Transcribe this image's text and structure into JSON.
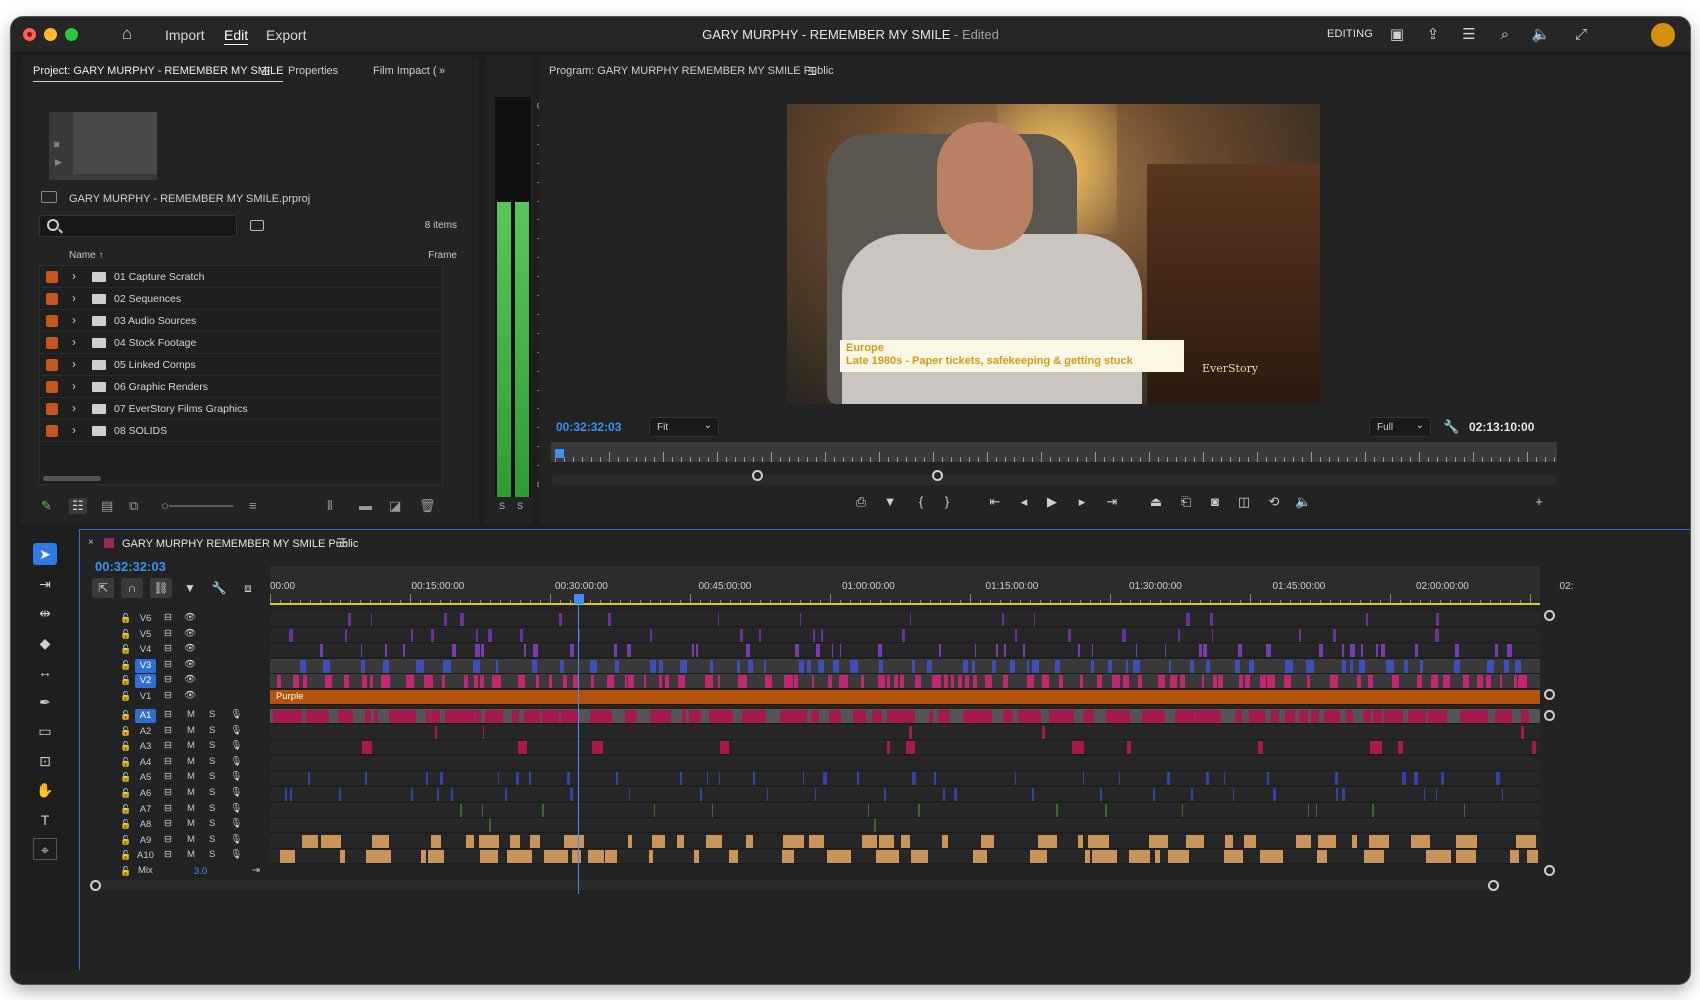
{
  "app": {
    "title": "GARY MURPHY - REMEMBER MY SMILE",
    "title_suffix": "- Edited",
    "menu": [
      "Import",
      "Edit",
      "Export"
    ],
    "workspace": "EDITING",
    "accent": "#3d8ff5"
  },
  "project_panel": {
    "tabs": [
      "Project: GARY MURPHY - REMEMBER MY SMILE",
      "Properties",
      "Film Impact ("
    ],
    "file_name": "GARY MURPHY - REMEMBER MY SMILE.prproj",
    "items_count": "8 items",
    "columns": {
      "name": "Name",
      "frame": "Frame"
    },
    "bins": [
      {
        "label": "01 Capture Scratch",
        "color": "#c4561e"
      },
      {
        "label": "02 Sequences",
        "color": "#c4561e"
      },
      {
        "label": "03 Audio Sources",
        "color": "#c4561e"
      },
      {
        "label": "04 Stock Footage",
        "color": "#c4561e"
      },
      {
        "label": "05 Linked Comps",
        "color": "#c4561e"
      },
      {
        "label": "06 Graphic Renders",
        "color": "#c4561e"
      },
      {
        "label": "07 EverStory Films Graphics",
        "color": "#c4561e"
      },
      {
        "label": "08 SOLIDS",
        "color": "#c4561e"
      }
    ]
  },
  "audio_meter": {
    "ticks": [
      "0",
      "-3",
      "-6",
      "-9",
      "-12",
      "-15",
      "-18",
      "-21",
      "-24",
      "-27",
      "-30",
      "-33",
      "-36",
      "-39",
      "-42",
      "-45",
      "-48",
      "-51",
      "-54",
      "-57",
      "dB"
    ],
    "solo_labels": [
      "S",
      "S"
    ],
    "level_fraction": 0.76
  },
  "program_monitor": {
    "title": "Program: GARY MURPHY REMEMBER MY SMILE Public",
    "timecode": "00:32:32:03",
    "fit": "Fit",
    "resolution": "Full",
    "duration": "02:13:10:00",
    "lower_third": {
      "line1": "Europe",
      "line2": "Late 1980s - Paper tickets, safekeeping & getting stuck"
    },
    "watermark": "EverStory"
  },
  "timeline": {
    "sequence_name": "GARY MURPHY REMEMBER MY SMILE Public",
    "timecode": "00:32:32:03",
    "ruler_labels": [
      "00:00",
      "00:15:00:00",
      "00:30:00:00",
      "00:45:00:00",
      "01:00:00:00",
      "01:15:00:00",
      "01:30:00:00",
      "01:45:00:00",
      "02:00:00:00",
      "02:"
    ],
    "video_tracks": [
      "V6",
      "V5",
      "V4",
      "V3",
      "V2",
      "V1"
    ],
    "audio_tracks": [
      "A1",
      "A2",
      "A3",
      "A4",
      "A5",
      "A6",
      "A7",
      "A8",
      "A9",
      "A10"
    ],
    "track_toggles": {
      "mute": "M",
      "solo": "S"
    },
    "v1_clip": "Purple",
    "mix_label": "Mix",
    "mix_value": "3.0"
  }
}
